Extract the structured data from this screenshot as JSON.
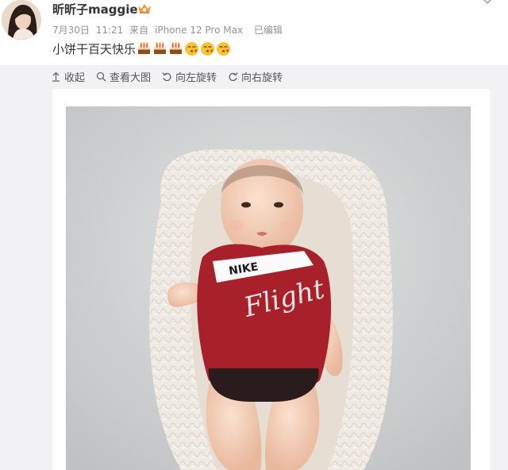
{
  "post": {
    "username": "昕昕子maggie",
    "date": "7月30日",
    "time": "11:21",
    "source_prefix": "来自",
    "source_device": "iPhone 12 Pro Max",
    "edited": "已编辑",
    "text": "小饼干百天快乐",
    "emojis": [
      "cake-icon",
      "cake-icon",
      "cake-icon",
      "kiss-face-icon",
      "kiss-face-icon",
      "kiss-face-icon"
    ]
  },
  "toolbar": {
    "collapse": "收起",
    "view_large": "查看大图",
    "rotate_left": "向左旋转",
    "rotate_right": "向右旋转"
  },
  "photo": {
    "shirt_logo": "NIKE",
    "shirt_script": "Flight"
  },
  "colors": {
    "accent": "#e5853b",
    "meta_text": "#939393",
    "media_bg": "#f2f2f5",
    "shirt_red": "#a8202a"
  }
}
